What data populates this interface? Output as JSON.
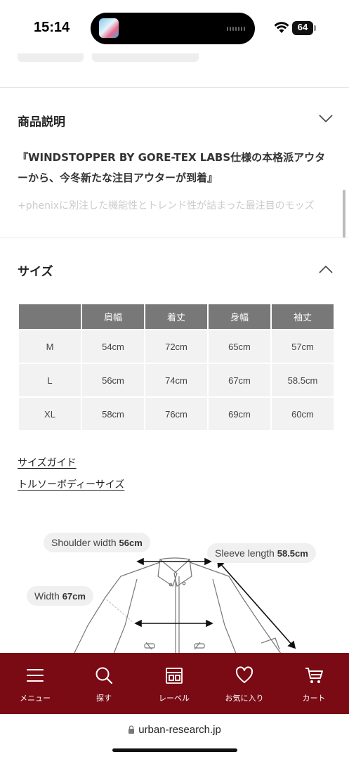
{
  "status_bar": {
    "time": "15:14",
    "battery": "64"
  },
  "description": {
    "heading": "商品説明",
    "bold_text": "『WINDSTOPPER BY GORE-TEX LABS仕様の本格派アウターから、今冬新たな注目アウターが到着』",
    "faded_text": "+phenixに別注した機能性とトレンド性が詰まった最注目のモッズ"
  },
  "size": {
    "heading": "サイズ",
    "headers": [
      "",
      "肩幅",
      "着丈",
      "身幅",
      "袖丈"
    ],
    "rows": [
      [
        "M",
        "54cm",
        "72cm",
        "65cm",
        "57cm"
      ],
      [
        "L",
        "56cm",
        "74cm",
        "67cm",
        "58.5cm"
      ],
      [
        "XL",
        "58cm",
        "76cm",
        "69cm",
        "60cm"
      ]
    ],
    "guide_link": "サイズガイド",
    "torso_link": "トルソーボディーサイズ"
  },
  "diagram": {
    "shoulder_label": "Shoulder width",
    "shoulder_value": "56cm",
    "sleeve_label": "Sleeve length",
    "sleeve_value": "58.5cm",
    "width_label": "Width",
    "width_value": "67cm"
  },
  "bottom_nav": {
    "items": [
      {
        "label": "メニュー",
        "icon": "menu-icon"
      },
      {
        "label": "探す",
        "icon": "search-icon"
      },
      {
        "label": "レーベル",
        "icon": "store-icon"
      },
      {
        "label": "お気に入り",
        "icon": "heart-icon"
      },
      {
        "label": "カート",
        "icon": "cart-icon"
      }
    ]
  },
  "browser": {
    "url": "urban-research.jp"
  },
  "colors": {
    "nav_bg": "#7a0a14",
    "table_header": "#787878",
    "table_cell": "#f2f2f2"
  }
}
